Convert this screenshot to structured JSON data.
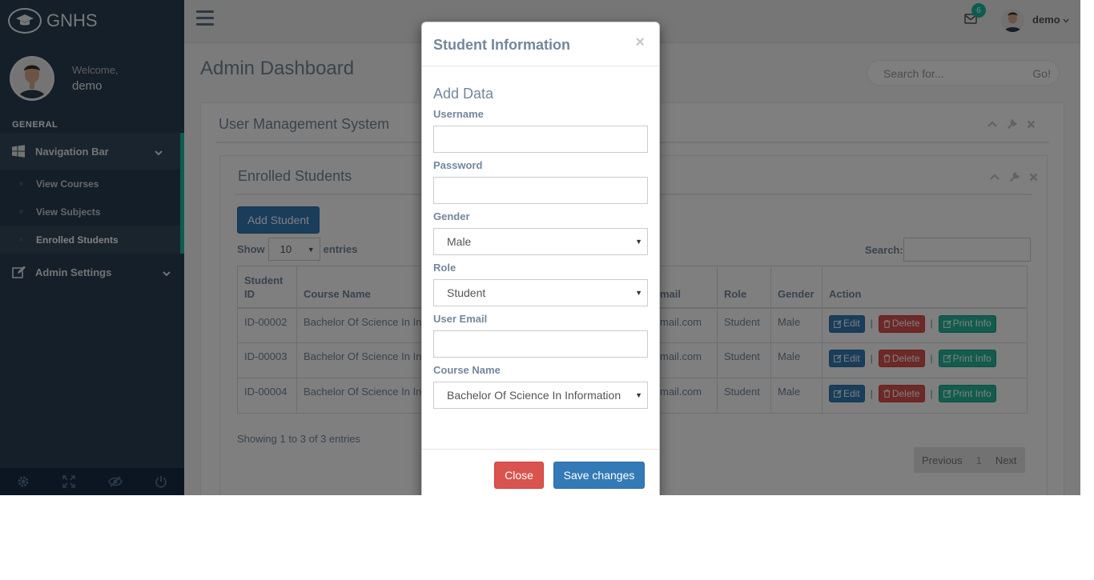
{
  "brand": {
    "name": "GNHS",
    "logo_icon": "graduation-cap-icon"
  },
  "profile": {
    "welcome": "Welcome,",
    "name": "demo"
  },
  "sidebar": {
    "section_title": "GENERAL",
    "nav_bar": {
      "label": "Navigation Bar",
      "icon": "windows-icon"
    },
    "sub_items": [
      {
        "label": "View Courses"
      },
      {
        "label": "View Subjects"
      },
      {
        "label": "Enrolled Students"
      }
    ],
    "admin_settings": {
      "label": "Admin Settings",
      "icon": "edit-icon"
    },
    "footer_icons": [
      "settings-icon",
      "fullscreen-icon",
      "lock-icon",
      "power-icon"
    ]
  },
  "topbar": {
    "mail_count": "6",
    "user_name": "demo"
  },
  "main": {
    "page_title": "Admin Dashboard",
    "search_placeholder": "Search for...",
    "search_go": "Go!",
    "outer_panel_title": "User Management System",
    "inner_panel_title": "Enrolled Students",
    "add_button": "Add Student",
    "show_label": "Show",
    "entries_value": "10",
    "entries_label": "entries",
    "table_search_label": "Search:",
    "columns": [
      "Student\nID",
      "Course Name",
      "mail",
      "Role",
      "Gender",
      "Action"
    ],
    "rows": [
      {
        "id": "ID-00002",
        "course": "Bachelor Of Science In Inf",
        "email": "mail.com",
        "role": "Student",
        "gender": "Male"
      },
      {
        "id": "ID-00003",
        "course": "Bachelor Of Science In Inf",
        "email": "mail.com",
        "role": "Student",
        "gender": "Male"
      },
      {
        "id": "ID-00004",
        "course": "Bachelor Of Science In Inf",
        "email": "mail.com",
        "role": "Student",
        "gender": "Male"
      }
    ],
    "action_labels": {
      "edit": "Edit",
      "delete": "Delete",
      "print": "Print Info"
    },
    "info_text": "Showing 1 to 3 of 3 entries",
    "pager": {
      "previous": "Previous",
      "current": "1",
      "next": "Next"
    }
  },
  "modal": {
    "title": "Student Information",
    "close_symbol": "×",
    "subtitle": "Add Data",
    "username_label": "Username",
    "password_label": "Password",
    "gender_label": "Gender",
    "gender_value": "Male",
    "role_label": "Role",
    "role_value": "Student",
    "email_label": "User Email",
    "course_label": "Course Name",
    "course_value": "Bachelor Of Science In Information",
    "close_button": "Close",
    "save_button": "Save changes"
  },
  "colors": {
    "sidebar": "#2a3f54",
    "accent": "#1ABB9C",
    "primary": "#337ab7",
    "danger": "#d9534f",
    "success": "#26B99A"
  }
}
